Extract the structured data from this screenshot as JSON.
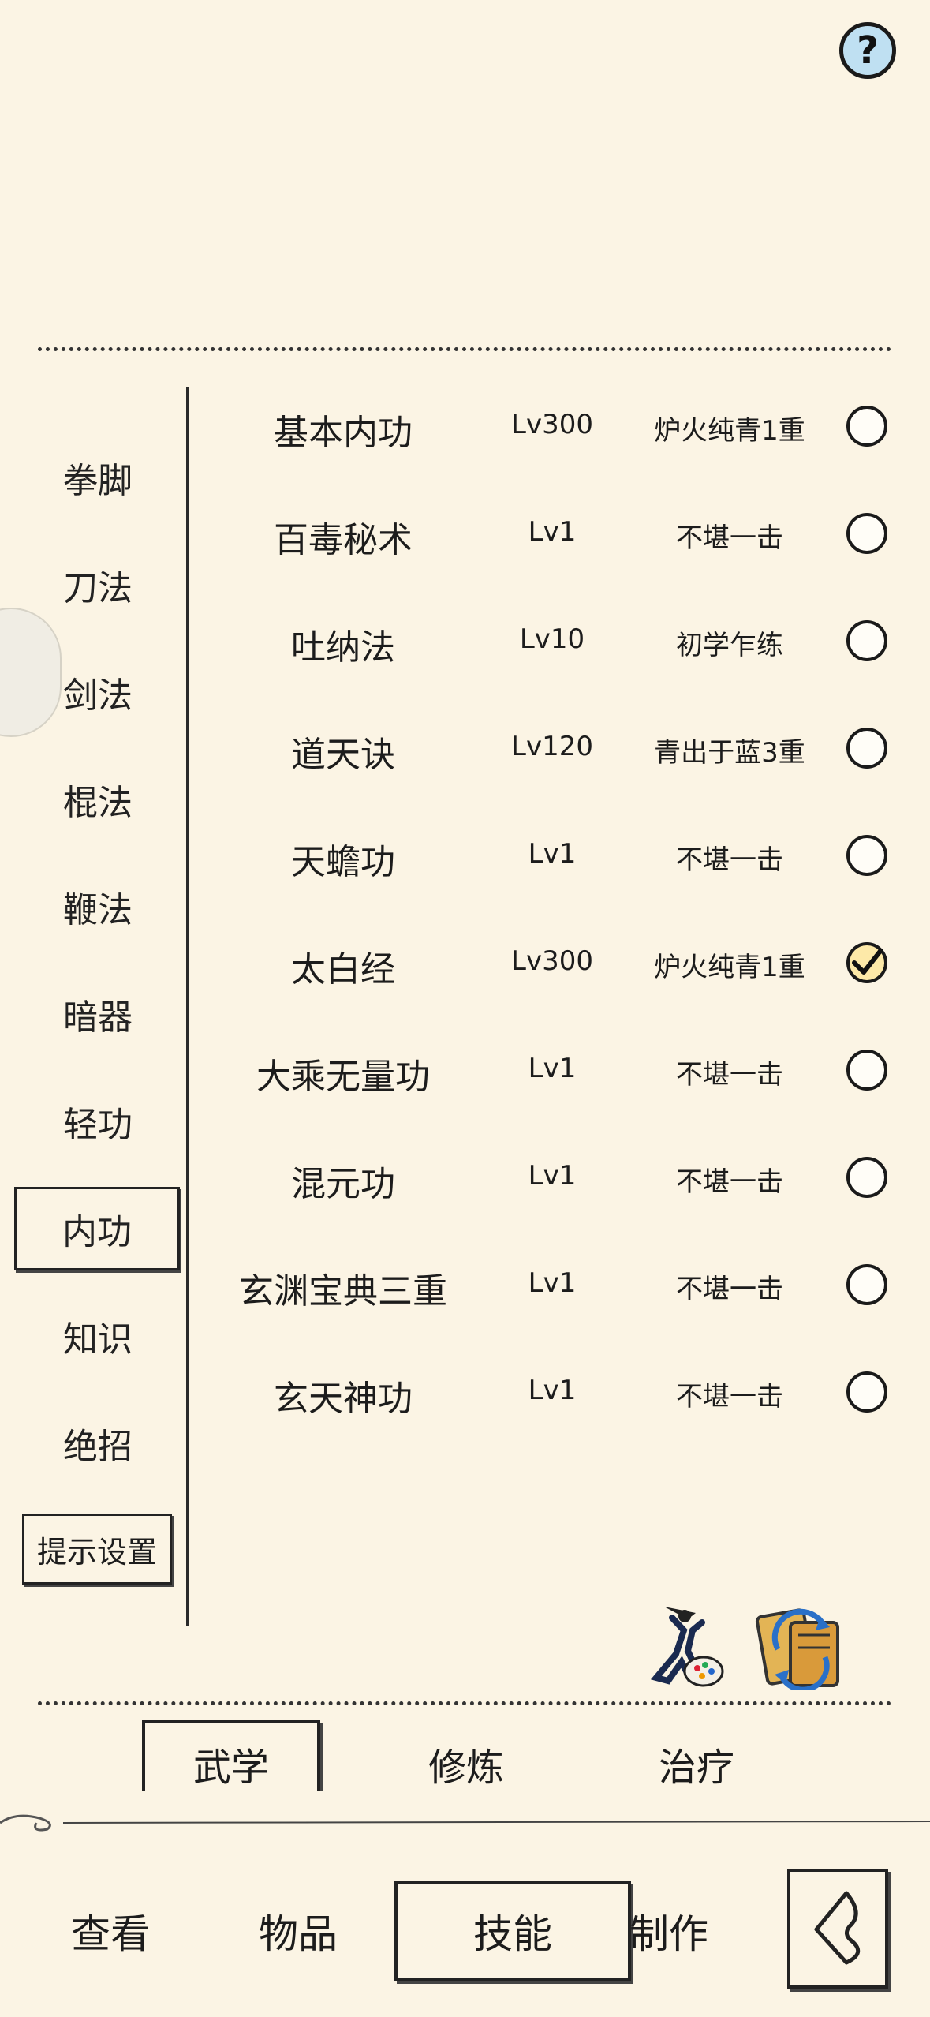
{
  "help_label": "?",
  "categories": [
    {
      "label": "拳脚"
    },
    {
      "label": "刀法"
    },
    {
      "label": "剑法"
    },
    {
      "label": "棍法"
    },
    {
      "label": "鞭法"
    },
    {
      "label": "暗器"
    },
    {
      "label": "轻功"
    },
    {
      "label": "内功",
      "active": true
    },
    {
      "label": "知识"
    },
    {
      "label": "绝招"
    }
  ],
  "tip_settings_label": "提示设置",
  "skills": [
    {
      "name": "基本内功",
      "level": "Lv300",
      "rank": "炉火纯青1重",
      "checked": false
    },
    {
      "name": "百毒秘术",
      "level": "Lv1",
      "rank": "不堪一击",
      "checked": false
    },
    {
      "name": "吐纳法",
      "level": "Lv10",
      "rank": "初学乍练",
      "checked": false
    },
    {
      "name": "道天诀",
      "level": "Lv120",
      "rank": "青出于蓝3重",
      "checked": false
    },
    {
      "name": "天蟾功",
      "level": "Lv1",
      "rank": "不堪一击",
      "checked": false
    },
    {
      "name": "太白经",
      "level": "Lv300",
      "rank": "炉火纯青1重",
      "checked": true
    },
    {
      "name": "大乘无量功",
      "level": "Lv1",
      "rank": "不堪一击",
      "checked": false
    },
    {
      "name": "混元功",
      "level": "Lv1",
      "rank": "不堪一击",
      "checked": false
    },
    {
      "name": "玄渊宝典三重",
      "level": "Lv1",
      "rank": "不堪一击",
      "checked": false
    },
    {
      "name": "玄天神功",
      "level": "Lv1",
      "rank": "不堪一击",
      "checked": false
    }
  ],
  "sub_tabs": {
    "martial": "武学",
    "cultivate": "修炼",
    "heal": "治疗"
  },
  "main_tabs": {
    "view": "查看",
    "items": "物品",
    "skills": "技能",
    "craft": "制作"
  },
  "icons": {
    "palette": "warrior-palette-icon",
    "book": "scroll-swap-icon",
    "back": "back-arrow-icon",
    "help": "help-icon"
  },
  "colors": {
    "background": "#fbf4e4",
    "check_fill": "#fde9a8",
    "help_fill": "#bfe0f2"
  }
}
